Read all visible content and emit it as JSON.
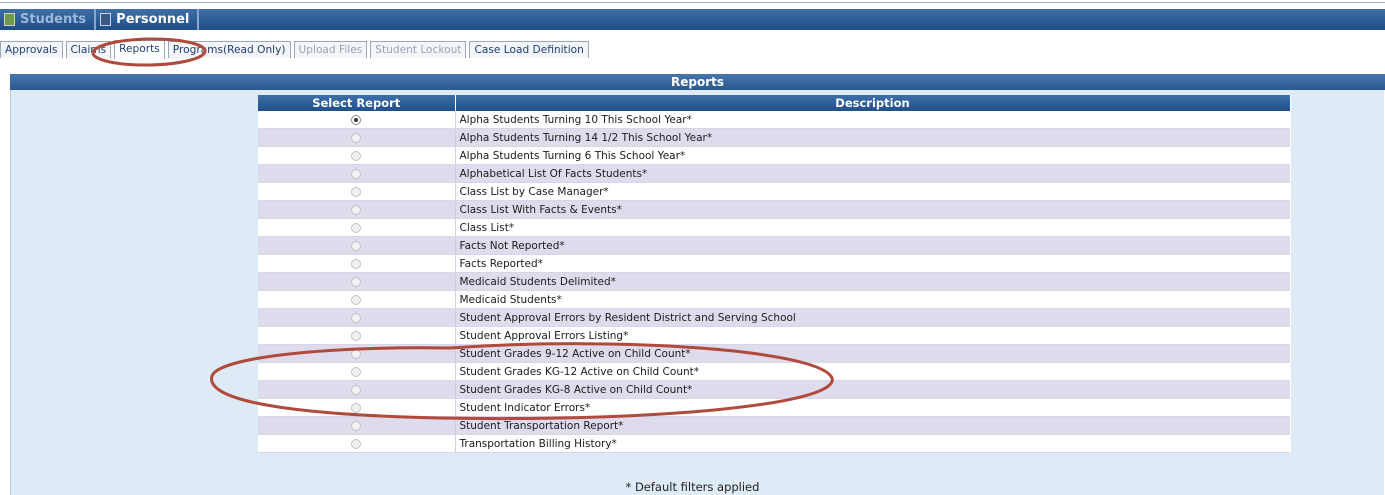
{
  "topnav": [
    {
      "label": "Students",
      "icon": "folder-icon",
      "active": false
    },
    {
      "label": "Personnel",
      "icon": "person-icon",
      "active": true
    }
  ],
  "tabs": [
    {
      "label": "Approvals",
      "state": "normal"
    },
    {
      "label": "Claims",
      "state": "normal"
    },
    {
      "label": "Reports",
      "state": "active"
    },
    {
      "label": "Programs(Read Only)",
      "state": "normal"
    },
    {
      "label": "Upload Files",
      "state": "disabled"
    },
    {
      "label": "Student Lockout",
      "state": "disabled"
    },
    {
      "label": "Case Load Definition",
      "state": "normal"
    }
  ],
  "panel": {
    "title": "Reports"
  },
  "table": {
    "columns": [
      "Select Report",
      "Description"
    ],
    "rows": [
      {
        "description": "Alpha Students Turning 10 This School Year*",
        "selected": true
      },
      {
        "description": "Alpha Students Turning 14 1/2 This School Year*",
        "selected": false
      },
      {
        "description": "Alpha Students Turning 6 This School Year*",
        "selected": false
      },
      {
        "description": "Alphabetical List Of Facts Students*",
        "selected": false
      },
      {
        "description": "Class List by Case Manager*",
        "selected": false
      },
      {
        "description": "Class List With Facts & Events*",
        "selected": false
      },
      {
        "description": "Class List*",
        "selected": false
      },
      {
        "description": "Facts Not Reported*",
        "selected": false
      },
      {
        "description": "Facts Reported*",
        "selected": false
      },
      {
        "description": "Medicaid Students Delimited*",
        "selected": false
      },
      {
        "description": "Medicaid Students*",
        "selected": false
      },
      {
        "description": "Student Approval Errors by Resident District and Serving School",
        "selected": false
      },
      {
        "description": "Student Approval Errors Listing*",
        "selected": false
      },
      {
        "description": "Student Grades 9-12 Active on Child Count*",
        "selected": false
      },
      {
        "description": "Student Grades KG-12 Active on Child Count*",
        "selected": false
      },
      {
        "description": "Student Grades KG-8 Active on Child Count*",
        "selected": false
      },
      {
        "description": "Student Indicator Errors*",
        "selected": false
      },
      {
        "description": "Student Transportation Report*",
        "selected": false
      },
      {
        "description": "Transportation Billing History*",
        "selected": false
      }
    ]
  },
  "footnote": "* Default filters applied",
  "colors": {
    "header_blue": "#2a578e",
    "panel_bg": "#deeaf6",
    "alt_row": "#dedcec",
    "annotation": "#b04a3c"
  }
}
